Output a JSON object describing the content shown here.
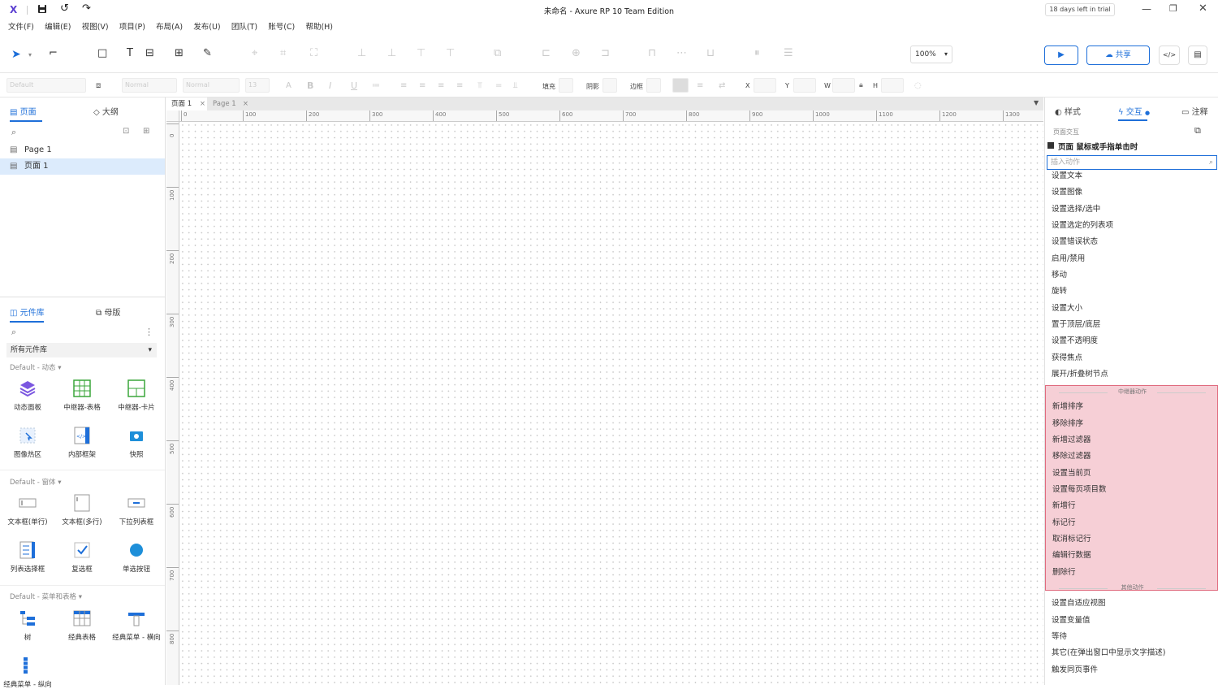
{
  "titlebar": {
    "title": "未命名 - Axure RP 10 Team Edition",
    "trial": "18 days left in trial",
    "colors": {
      "logo": "#5b3fd1"
    }
  },
  "menu": [
    "文件(F)",
    "编辑(E)",
    "视图(V)",
    "项目(P)",
    "布局(A)",
    "发布(U)",
    "团队(T)",
    "账号(C)",
    "帮助(H)"
  ],
  "toolbar": {
    "zoom": "100%",
    "share_label": "共享",
    "accent": "#1e6fd9"
  },
  "formatbar": {
    "font_family": "Default",
    "font_style": "Normal",
    "font_weight": "Normal",
    "font_size": "13",
    "fill_label": "填充",
    "shadow_label": "阴影",
    "border_label": "边框",
    "x_label": "X",
    "y_label": "Y",
    "w_label": "W",
    "h_label": "H"
  },
  "left": {
    "tab_pages": "页面",
    "tab_outline": "大纲",
    "pages": [
      "Page 1",
      "页面 1"
    ],
    "tab_library": "元件库",
    "tab_masters": "母版",
    "library_select": "所有元件库",
    "sections": [
      {
        "title": "Default - 动态 ▾",
        "items": [
          "动态面板",
          "中继器-表格",
          "中继器-卡片",
          "图像热区",
          "内部框架",
          "快照"
        ]
      },
      {
        "title": "Default - 窗体 ▾",
        "items": [
          "文本框(单行)",
          "文本框(多行)",
          "下拉列表框",
          "列表选择框",
          "复选框",
          "单选按钮"
        ]
      },
      {
        "title": "Default - 菜单和表格 ▾",
        "items": [
          "树",
          "经典表格",
          "经典菜单 - 横向"
        ]
      }
    ],
    "last_item": "经典菜单 - 纵向"
  },
  "canvas": {
    "tabs": [
      "页面 1",
      "Page 1"
    ],
    "hruler": [
      "0",
      "100",
      "200",
      "300",
      "400",
      "500",
      "600",
      "700",
      "800",
      "900",
      "1000",
      "1100",
      "1200",
      "1300"
    ],
    "vruler": [
      "0",
      "100",
      "200",
      "300",
      "400",
      "500",
      "600",
      "700",
      "800"
    ]
  },
  "right": {
    "tab_style": "样式",
    "tab_interaction": "交互",
    "tab_notes": "注释",
    "subtitle": "页面交互",
    "event": "页面 鼠标或手指单击时",
    "search_placeholder": "插入动作",
    "actions_general": [
      "设置文本",
      "设置图像",
      "设置选择/选中",
      "设置选定的列表项",
      "设置错误状态",
      "启用/禁用",
      "移动",
      "旋转",
      "设置大小",
      "置于顶层/底层",
      "设置不透明度",
      "获得焦点",
      "展开/折叠树节点"
    ],
    "repeater_header": "中继器动作",
    "actions_repeater": [
      "新增排序",
      "移除排序",
      "新增过滤器",
      "移除过滤器",
      "设置当前页",
      "设置每页项目数",
      "新增行",
      "标记行",
      "取消标记行",
      "编辑行数据",
      "删除行"
    ],
    "other_header": "其他动作",
    "actions_other": [
      "设置自适应视图",
      "设置变量值",
      "等待",
      "其它(在弹出窗口中显示文字描述)",
      "触发同页事件"
    ],
    "highlight_color": "#f6cfd6"
  }
}
